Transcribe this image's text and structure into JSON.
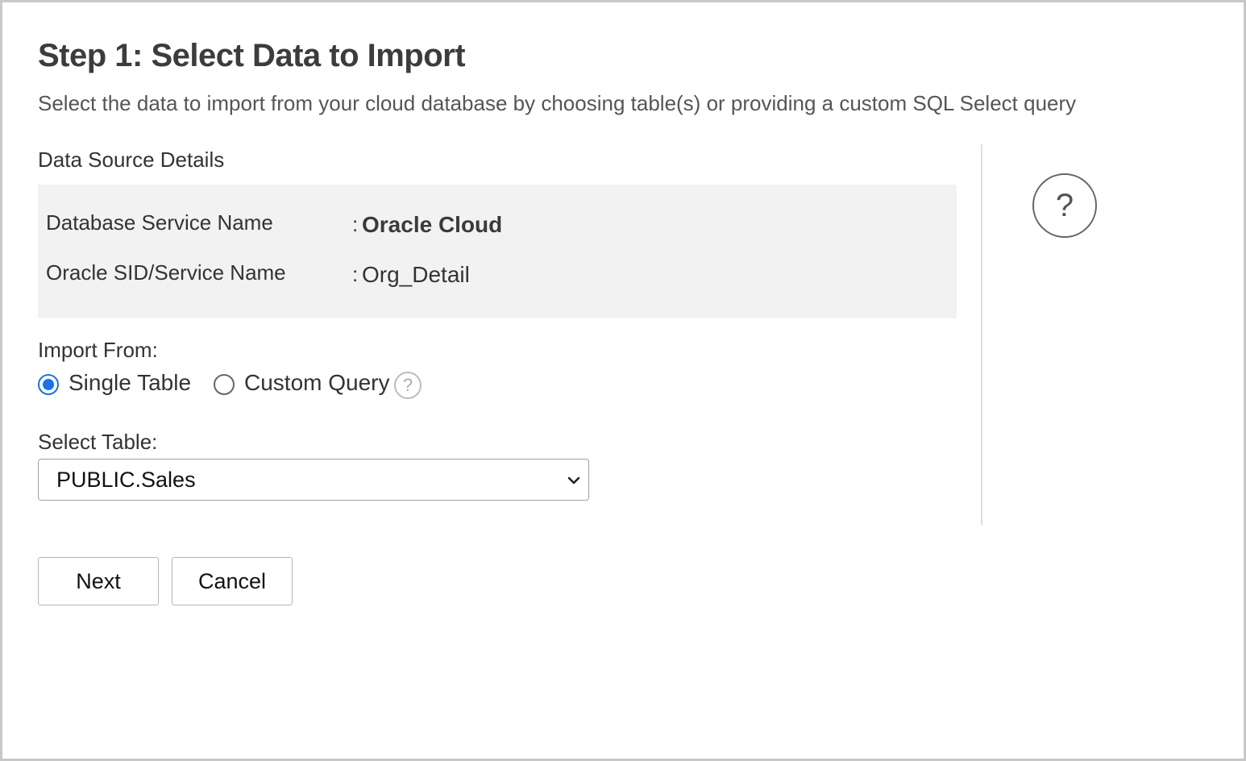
{
  "header": {
    "title": "Step 1: Select Data to Import",
    "subtitle": "Select the data to import from your cloud database by choosing table(s) or providing a custom SQL Select query"
  },
  "data_source": {
    "section_title": "Data Source Details",
    "rows": [
      {
        "label": "Database Service Name",
        "separator": ":",
        "value": "Oracle Cloud"
      },
      {
        "label": "Oracle SID/Service Name",
        "separator": ":",
        "value": "Org_Detail"
      }
    ]
  },
  "help": {
    "symbol": "?"
  },
  "import_from": {
    "label": "Import From:",
    "options": [
      {
        "label": "Single Table",
        "selected": true
      },
      {
        "label": "Custom Query",
        "selected": false
      }
    ],
    "help_symbol": "?"
  },
  "select_table": {
    "label": "Select Table:",
    "value": "PUBLIC.Sales"
  },
  "actions": {
    "next_label": "Next",
    "cancel_label": "Cancel"
  },
  "colors": {
    "accent": "#1a73e8",
    "panel_bg": "#f2f2f2",
    "border": "#c8c8c8"
  }
}
